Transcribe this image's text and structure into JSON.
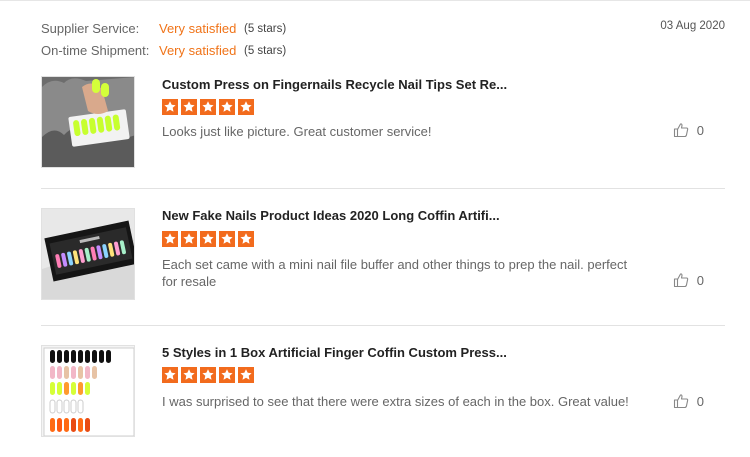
{
  "summary": {
    "supplier_service": {
      "label": "Supplier Service:",
      "value": "Very satisfied",
      "note": "(5 stars)"
    },
    "ontime_shipment": {
      "label": "On-time Shipment:",
      "value": "Very satisfied",
      "note": "(5 stars)"
    },
    "date": "03 Aug 2020"
  },
  "colors": {
    "accent": "#f07318",
    "star": "#f26b1d",
    "divider": "#e2e2e2"
  },
  "reviews": [
    {
      "title": "Custom Press on Fingernails Recycle Nail Tips Set Re...",
      "rating": 5,
      "text": "Looks just like picture. Great customer service!",
      "likes": "0",
      "image_icon": "product-photo-nail-tips-fur"
    },
    {
      "title": "New Fake Nails Product Ideas 2020 Long Coffin Artifi...",
      "rating": 5,
      "text": "Each set came with a mini nail file buffer and other things to prep the nail. perfect for resale",
      "likes": "0",
      "image_icon": "product-photo-nail-box"
    },
    {
      "title": "5 Styles in 1 Box Artificial Finger Coffin Custom Press...",
      "rating": 5,
      "text": "I was surprised to see that there were extra sizes of each in the box. Great value!",
      "likes": "0",
      "image_icon": "product-photo-nail-styles"
    }
  ]
}
